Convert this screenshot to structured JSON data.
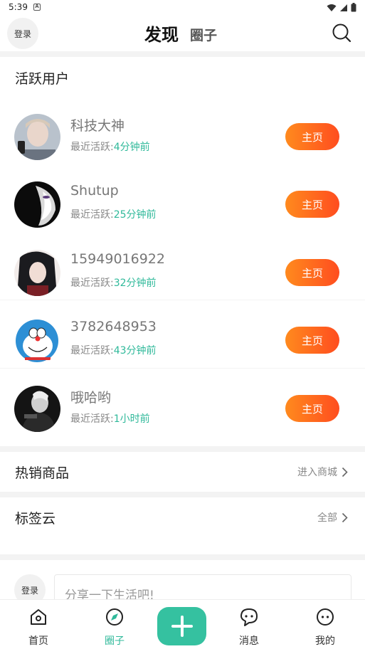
{
  "status": {
    "time": "5:39",
    "app_indicator": "A"
  },
  "header": {
    "login": "登录",
    "title": "发现",
    "subtitle": "圈子"
  },
  "active_users": {
    "title": "活跃用户",
    "active_prefix": "最近活跃:",
    "button": "主页",
    "users": [
      {
        "name": "科技大神",
        "ago": "4分钟前"
      },
      {
        "name": "Shutup",
        "ago": "25分钟前"
      },
      {
        "name": "15949016922",
        "ago": "32分钟前"
      },
      {
        "name": "3782648953",
        "ago": "43分钟前"
      },
      {
        "name": "哦哈哟",
        "ago": "1小时前"
      }
    ]
  },
  "hot_goods": {
    "label": "热销商品",
    "link": "进入商城"
  },
  "tag_cloud": {
    "label": "标签云",
    "link": "全部"
  },
  "composer": {
    "login": "登录",
    "placeholder": "分享一下生活吧!"
  },
  "tabbar": {
    "tabs": [
      {
        "label": "首页",
        "icon": "home-icon"
      },
      {
        "label": "圈子",
        "icon": "compass-icon",
        "active": true
      },
      {
        "label": "消息",
        "icon": "chat-icon"
      },
      {
        "label": "我的",
        "icon": "profile-icon"
      }
    ],
    "post_icon": "plus-icon"
  },
  "colors": {
    "accent": "#2fb99a",
    "button_start": "#ff8a1e",
    "button_end": "#ff4d1f",
    "post_button": "#35c1a0"
  }
}
